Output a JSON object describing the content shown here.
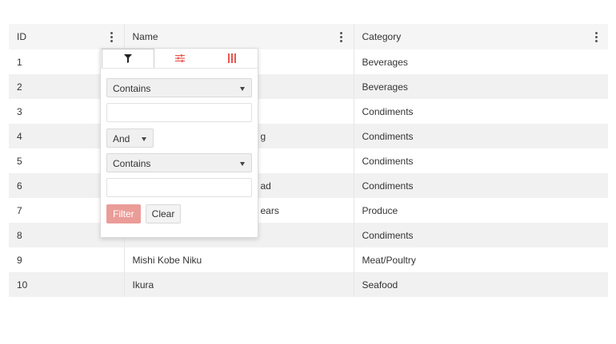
{
  "columns": [
    {
      "label": "ID"
    },
    {
      "label": "Name"
    },
    {
      "label": "Category"
    }
  ],
  "rows": [
    {
      "id": "1",
      "name": "",
      "category": "Beverages"
    },
    {
      "id": "2",
      "name": "",
      "category": "Beverages"
    },
    {
      "id": "3",
      "name": "",
      "category": "Condiments"
    },
    {
      "id": "4",
      "name": "g",
      "category": "Condiments"
    },
    {
      "id": "5",
      "name": "",
      "category": "Condiments"
    },
    {
      "id": "6",
      "name": "ad",
      "category": "Condiments"
    },
    {
      "id": "7",
      "name": "ears",
      "category": "Produce"
    },
    {
      "id": "8",
      "name": "",
      "category": "Condiments"
    },
    {
      "id": "9",
      "name": "Mishi Kobe Niku",
      "category": "Meat/Poultry"
    },
    {
      "id": "10",
      "name": "Ikura",
      "category": "Seafood"
    }
  ],
  "filter_popup": {
    "tabs": [
      {
        "icon": "filter-icon",
        "active": true
      },
      {
        "icon": "sliders-icon",
        "active": false
      },
      {
        "icon": "columns-icon",
        "active": false
      }
    ],
    "operator_1": "Contains",
    "value_1": "",
    "logic": "And",
    "operator_2": "Contains",
    "value_2": "",
    "filter_label": "Filter",
    "clear_label": "Clear"
  },
  "colors": {
    "accent": "#e8574f",
    "filter_button": "#ea9c98",
    "header_bg": "#f5f5f5",
    "alt_row_bg": "#f1f1f1"
  }
}
